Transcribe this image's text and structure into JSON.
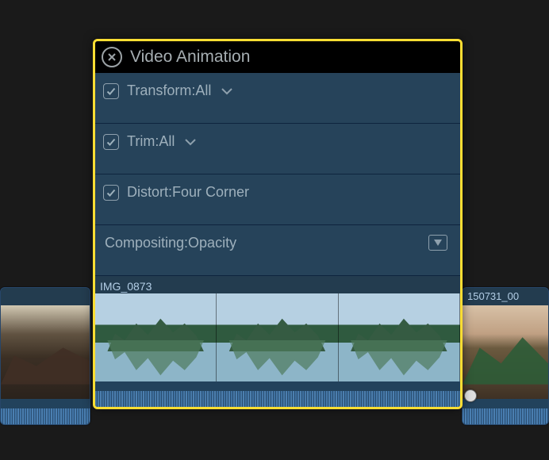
{
  "panel": {
    "title": "Video Animation",
    "rows": [
      {
        "label": "Transform:All",
        "checked": true,
        "has_chevron": true
      },
      {
        "label": "Trim:All",
        "checked": true,
        "has_chevron": true
      },
      {
        "label": "Distort:Four Corner",
        "checked": true,
        "has_chevron": false
      },
      {
        "label": "Compositing:Opacity",
        "checked": null,
        "has_chevron": false,
        "has_expand": true
      }
    ],
    "clip_name": "IMG_0873"
  },
  "timeline": {
    "left_clip_name": "",
    "right_clip_name": "150731_00"
  }
}
